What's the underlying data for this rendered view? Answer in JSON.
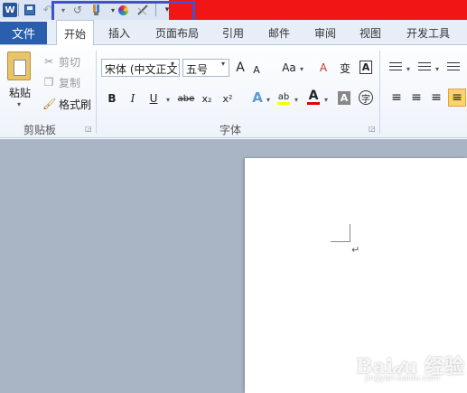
{
  "qat": {
    "word_logo": "W",
    "save_icon": "save-icon",
    "undo_icon": "↶",
    "redo_icon": "↺",
    "format_icon": "format-painter-icon",
    "color_icon": "color-wheel-icon",
    "pen_icon": "pen-icon",
    "customize_icon": "▾",
    "highlight_color": "#4252c8",
    "title_bar_color": "#f21515"
  },
  "tabs": {
    "file": "文件",
    "items": [
      "开始",
      "插入",
      "页面布局",
      "引用",
      "邮件",
      "审阅",
      "视图",
      "开发工具"
    ],
    "active_index": 0
  },
  "clipboard": {
    "paste": "粘贴",
    "cut": "剪切",
    "copy": "复制",
    "format_painter": "格式刷",
    "group_label": "剪贴板"
  },
  "font": {
    "name": "宋体 (中文正文)",
    "size": "五号",
    "grow": "A",
    "shrink": "A",
    "change_case": "Aa",
    "clear_format": "A",
    "phonetic": "变",
    "border_char": "A",
    "bold": "B",
    "italic": "I",
    "underline": "U",
    "strike": "abe",
    "subscript": "x₂",
    "superscript": "x²",
    "text_effect": "A",
    "highlight": "ab",
    "font_color": "A",
    "char_shading": "A",
    "enclose_char": "字",
    "group_label": "字体"
  },
  "paragraph": {
    "align_left": "≡",
    "align_center": "≡",
    "align_right": "≡",
    "justify": "≡"
  },
  "document": {
    "paragraph_mark": "↵"
  },
  "watermark": {
    "brand": "Bai𝒹u 经验",
    "url": "jingyan.baidu.com"
  }
}
